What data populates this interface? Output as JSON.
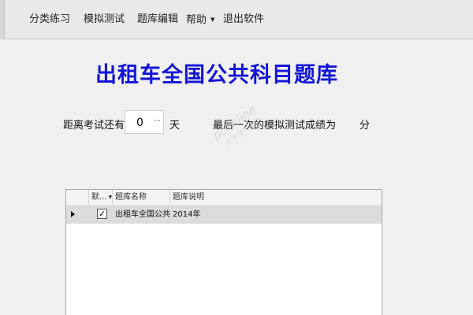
{
  "menubar": {
    "items": [
      {
        "label": "分类练习"
      },
      {
        "label": "模拟测试"
      },
      {
        "label": "题库编辑"
      },
      {
        "label": "帮助",
        "arrow": "▼"
      },
      {
        "label": "退出软件"
      }
    ]
  },
  "page": {
    "title": "出租车全国公共科目题库"
  },
  "exam": {
    "days_prefix": "距离考试还有",
    "days_value": "0",
    "days_spin_glyph": "···",
    "days_unit": "天",
    "score_label": "最后一次的模拟测试成绩为",
    "score_unit": "分"
  },
  "watermark": {
    "main": "pconline",
    "sub": "太平洋电脑网"
  },
  "grid": {
    "columns": [
      {
        "label": "默..."
      },
      {
        "label": "题库名称"
      },
      {
        "label": "题库说明"
      }
    ],
    "rows": [
      {
        "default_checked": true,
        "check_glyph": "✓",
        "name": "出租车全国公共...",
        "desc": "2014年"
      }
    ]
  }
}
